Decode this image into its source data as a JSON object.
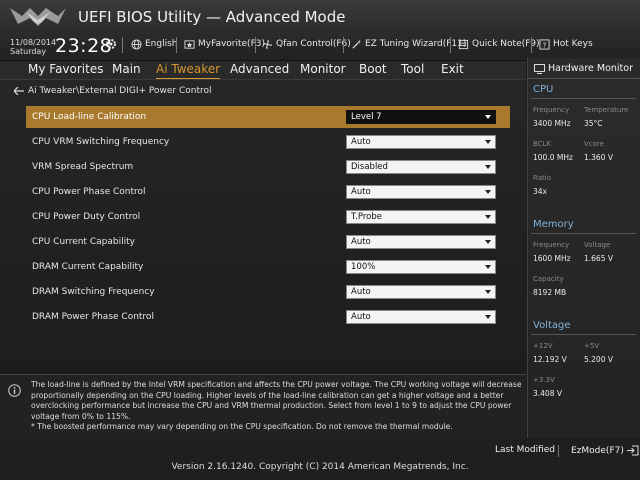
{
  "header": {
    "title": "UEFI BIOS Utility — Advanced Mode",
    "date": "11/08/2014",
    "day": "Saturday",
    "time": "23:28",
    "toolbar": [
      {
        "label": "English",
        "icon": "globe-icon"
      },
      {
        "label": "MyFavorite(F3)",
        "icon": "favorite-icon"
      },
      {
        "label": "Qfan Control(F6)",
        "icon": "fan-icon"
      },
      {
        "label": "EZ Tuning Wizard(F11)",
        "icon": "wizard-icon"
      },
      {
        "label": "Quick Note(F9)",
        "icon": "note-icon"
      },
      {
        "label": "Hot Keys",
        "icon": "help-icon"
      }
    ]
  },
  "menu": [
    {
      "label": "My Favorites"
    },
    {
      "label": "Main"
    },
    {
      "label": "Ai Tweaker",
      "active": true
    },
    {
      "label": "Advanced"
    },
    {
      "label": "Monitor"
    },
    {
      "label": "Boot"
    },
    {
      "label": "Tool"
    },
    {
      "label": "Exit"
    }
  ],
  "breadcrumb": "Ai Tweaker\\External DIGI+ Power Control",
  "settings": [
    {
      "label": "CPU Load-line Calibration",
      "value": "Level 7",
      "selected": true
    },
    {
      "label": "CPU VRM Switching Frequency",
      "value": "Auto"
    },
    {
      "label": "VRM Spread Spectrum",
      "value": "Disabled"
    },
    {
      "label": "CPU Power Phase Control",
      "value": "Auto"
    },
    {
      "label": "CPU Power Duty Control",
      "value": "T.Probe"
    },
    {
      "label": "CPU Current Capability",
      "value": "Auto"
    },
    {
      "label": "DRAM Current Capability",
      "value": "100%"
    },
    {
      "label": "DRAM Switching Frequency",
      "value": "Auto"
    },
    {
      "label": "DRAM Power Phase Control",
      "value": "Auto"
    }
  ],
  "info": {
    "text": "The load-line is defined by the Intel VRM specification and affects the CPU power voltage. The CPU working voltage will decrease proportionally depending on the CPU loading. Higher levels of the load-line calibration can get a higher voltage and a better overclocking performance but increase the CPU and VRM thermal production. Select from level 1 to 9 to adjust the CPU power voltage from 0% to 115%.",
    "note": "* The boosted performance may vary depending on the CPU specification. Do not remove the thermal module."
  },
  "hardware_monitor": {
    "title": "Hardware Monitor",
    "cpu": {
      "heading": "CPU",
      "frequency_label": "Frequency",
      "frequency": "3400 MHz",
      "temperature_label": "Temperature",
      "temperature": "35°C",
      "bclk_label": "BCLK",
      "bclk": "100.0 MHz",
      "vcore_label": "Vcore",
      "vcore": "1.360 V",
      "ratio_label": "Ratio",
      "ratio": "34x"
    },
    "memory": {
      "heading": "Memory",
      "frequency_label": "Frequency",
      "frequency": "1600 MHz",
      "voltage_label": "Voltage",
      "voltage": "1.665 V",
      "capacity_label": "Capacity",
      "capacity": "8192 MB"
    },
    "voltage": {
      "heading": "Voltage",
      "v12_label": "+12V",
      "v12": "12.192 V",
      "v5_label": "+5V",
      "v5": "5.200 V",
      "v33_label": "+3.3V",
      "v33": "3.408 V"
    }
  },
  "footer": {
    "last_modified": "Last Modified",
    "ezmode": "EzMode(F7)",
    "copyright": "Version 2.16.1240. Copyright (C) 2014 American Megatrends, Inc."
  },
  "colors": {
    "accent": "#d4962e",
    "selected_row": "#a87a2e",
    "section_heading": "#7fb0d8"
  }
}
